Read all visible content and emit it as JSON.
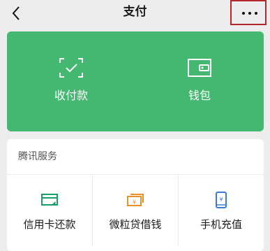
{
  "header": {
    "title": "支付",
    "back_icon": "chevron-left-icon",
    "more_icon": "more-dots-icon"
  },
  "wallet_card": {
    "color": "#44b770",
    "items": [
      {
        "label": "收付款",
        "icon": "scan-check-icon"
      },
      {
        "label": "钱包",
        "icon": "wallet-icon"
      }
    ]
  },
  "services": {
    "header": "腾讯服务",
    "items": [
      {
        "label": "信用卡还款",
        "icon": "credit-card-icon",
        "color": "#1a9f6b"
      },
      {
        "label": "微粒贷借钱",
        "icon": "loan-icon",
        "color": "#e8912d"
      },
      {
        "label": "手机充值",
        "icon": "phone-topup-icon",
        "color": "#3a7bd5"
      }
    ]
  }
}
